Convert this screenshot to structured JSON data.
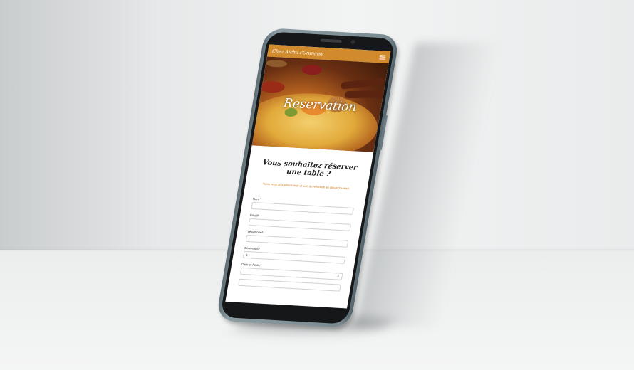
{
  "app": {
    "brand": "Chez Aicha l'Oranaise",
    "menu_icon": "hamburger-icon"
  },
  "hero": {
    "title": "Reservation"
  },
  "reservation": {
    "heading": "Vous souhaitez réserver une table ?",
    "info": "Nous vous accueillons midi et soir, du mercredi au dimanche midi."
  },
  "form": {
    "fields": [
      {
        "label": "Nom*",
        "value": ""
      },
      {
        "label": "Email*",
        "value": ""
      },
      {
        "label": "Téléphone*",
        "value": ""
      },
      {
        "label": "Couvert(s)*",
        "value": "1"
      },
      {
        "label": "Date et heure*",
        "value": ""
      }
    ]
  },
  "colors": {
    "accent": "#d18b2c",
    "info_text": "#cc7a1f"
  }
}
